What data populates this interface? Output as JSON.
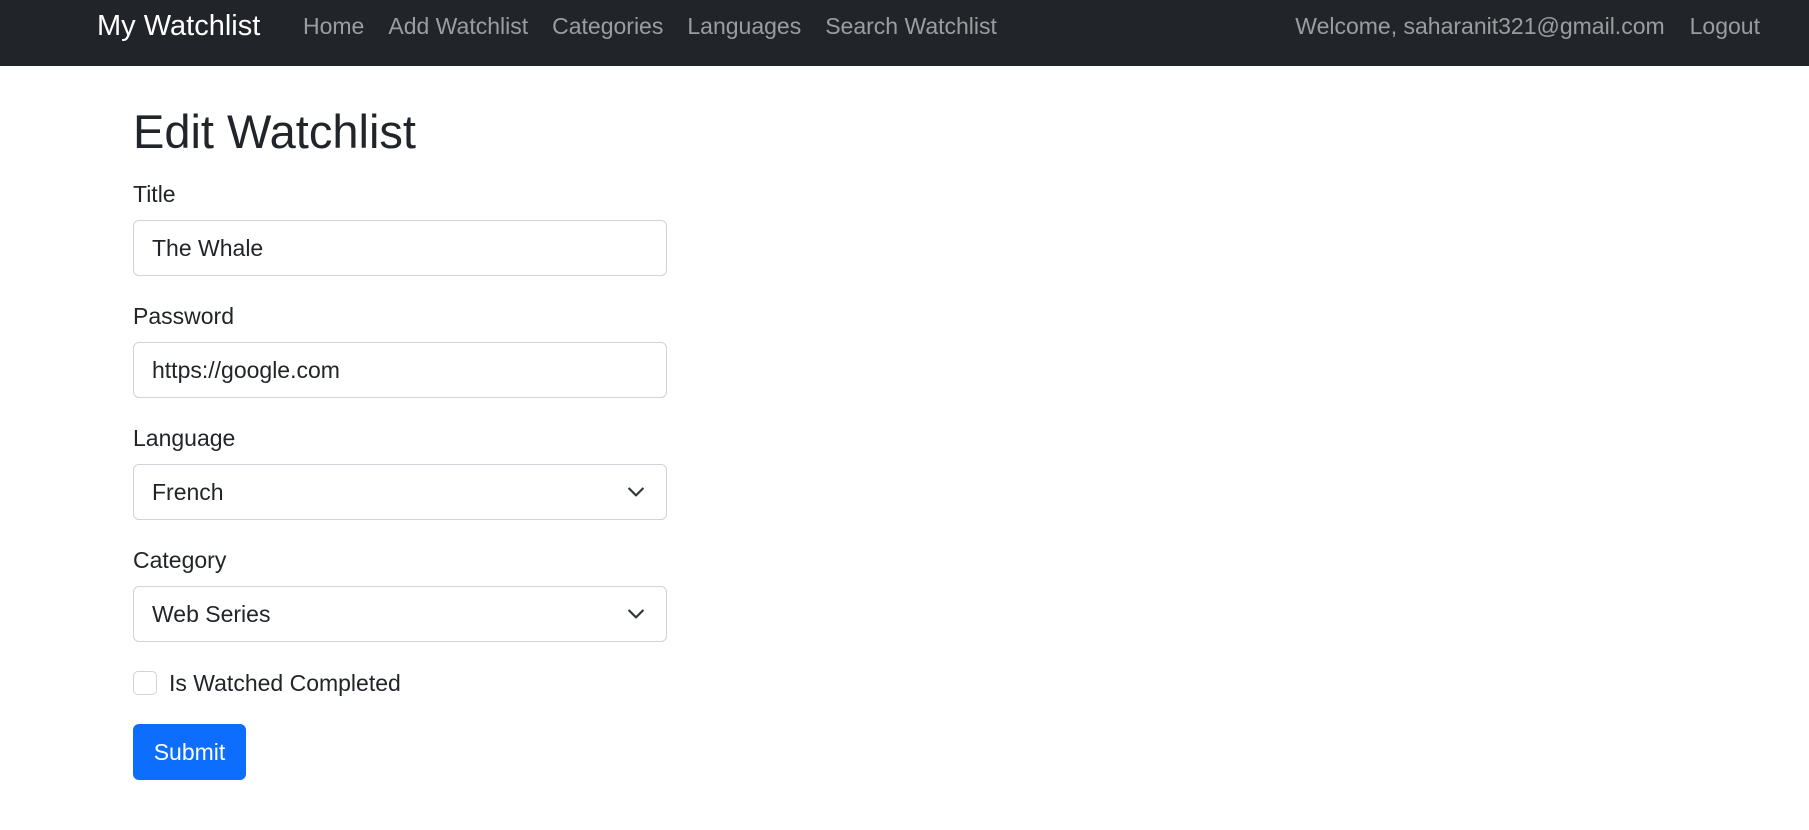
{
  "navbar": {
    "brand": "My Watchlist",
    "links": [
      "Home",
      "Add Watchlist",
      "Categories",
      "Languages",
      "Search Watchlist"
    ],
    "welcome": "Welcome, saharanit321@gmail.com",
    "logout": "Logout"
  },
  "page": {
    "title": "Edit Watchlist"
  },
  "form": {
    "title_label": "Title",
    "title_value": "The Whale",
    "password_label": "Password",
    "password_value": "https://google.com",
    "language_label": "Language",
    "language_value": "French",
    "category_label": "Category",
    "category_value": "Web Series",
    "watched_label": "Is Watched Completed",
    "watched_checked": false,
    "submit_label": "Submit"
  },
  "icons": {
    "language_chevron": "chevron-down-icon",
    "category_chevron": "chevron-down-icon"
  },
  "colors": {
    "navbar_bg": "#212529",
    "primary": "#0d6efd",
    "border": "#ced4da"
  }
}
